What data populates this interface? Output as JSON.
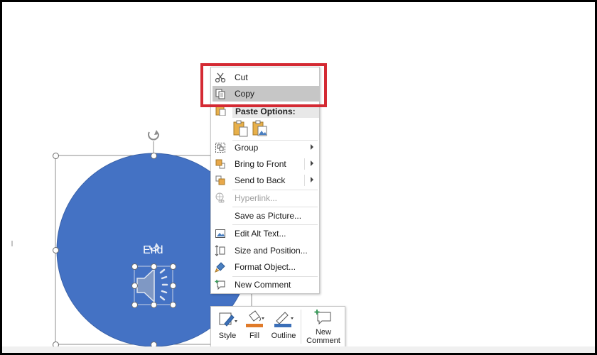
{
  "shape": {
    "label": "End",
    "fill_color": "#4472c4"
  },
  "context_menu": {
    "cut_label": "Cut",
    "copy_label": "Copy",
    "paste_options_label": "Paste Options:",
    "group_label": "Group",
    "bring_to_front_label": "Bring to Front",
    "send_to_back_label": "Send to Back",
    "hyperlink_label": "Hyperlink...",
    "save_as_picture_label": "Save as Picture...",
    "edit_alt_text_label": "Edit Alt Text...",
    "size_position_label": "Size and Position...",
    "format_object_label": "Format Object...",
    "new_comment_label": "New Comment"
  },
  "mini_toolbar": {
    "style_label": "Style",
    "fill_label": "Fill",
    "outline_label": "Outline",
    "new_comment_line1": "New",
    "new_comment_line2": "Comment"
  },
  "colors": {
    "highlight_box": "#d42a33",
    "menu_highlight": "#c6c6c6"
  }
}
